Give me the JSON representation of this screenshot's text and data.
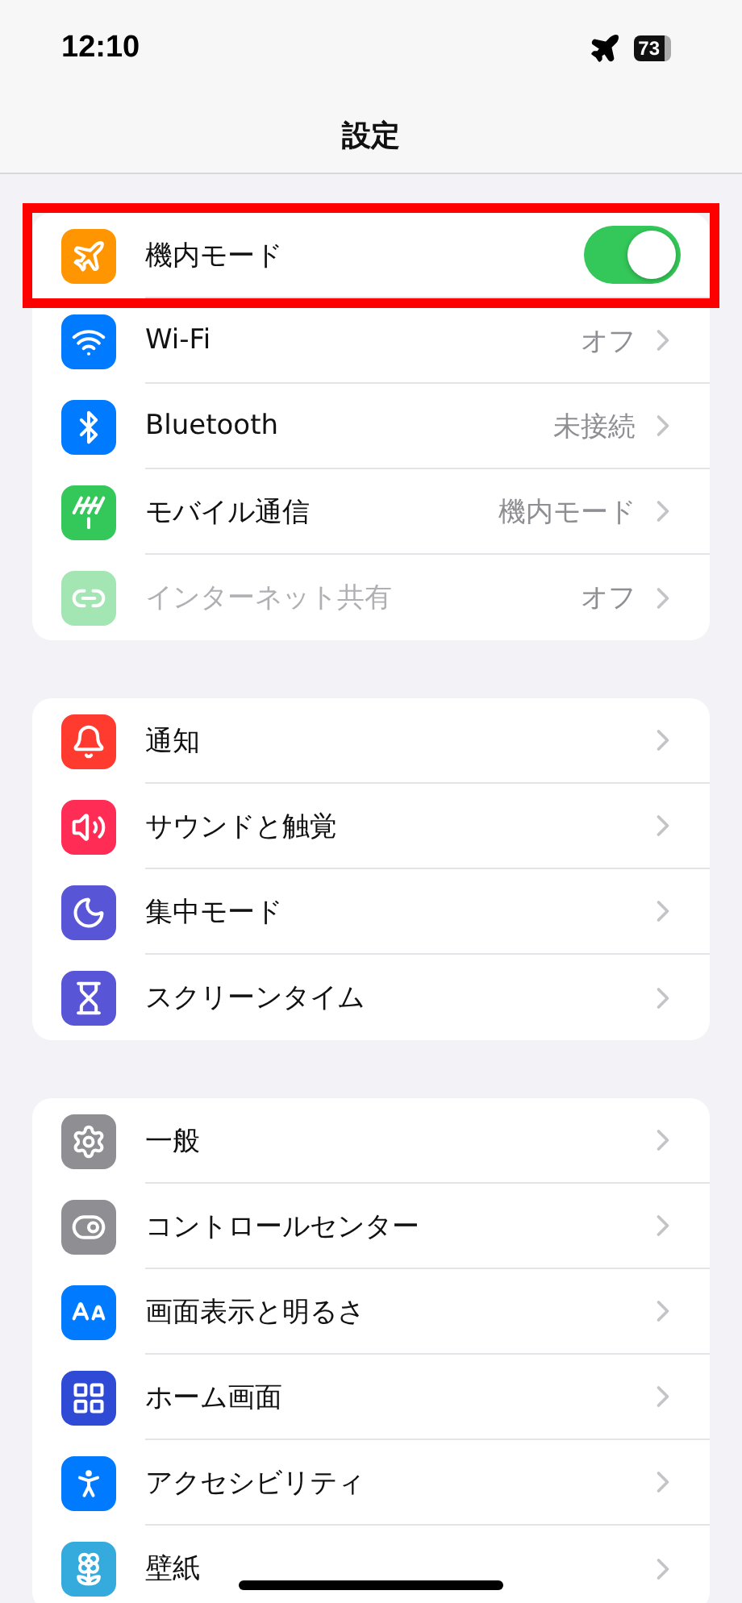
{
  "status_bar": {
    "time": "12:10",
    "airplane_mode": true,
    "battery": "73"
  },
  "nav": {
    "title": "設定"
  },
  "groups": [
    {
      "rows": [
        {
          "kind": "toggle",
          "label": "機内モード",
          "on": true,
          "highlighted": true,
          "disabled": false
        },
        {
          "kind": "link",
          "label": "Wi-Fi",
          "value": "オフ",
          "highlighted": false,
          "disabled": false
        },
        {
          "kind": "link",
          "label": "Bluetooth",
          "value": "未接続",
          "highlighted": false,
          "disabled": false
        },
        {
          "kind": "link",
          "label": "モバイル通信",
          "value": "機内モード",
          "highlighted": false,
          "disabled": false
        },
        {
          "kind": "link",
          "label": "インターネット共有",
          "value": "オフ",
          "highlighted": false,
          "disabled": true
        }
      ]
    },
    {
      "rows": [
        {
          "kind": "link",
          "label": "通知",
          "highlighted": false,
          "disabled": false
        },
        {
          "kind": "link",
          "label": "サウンドと触覚",
          "highlighted": false,
          "disabled": false
        },
        {
          "kind": "link",
          "label": "集中モード",
          "highlighted": false,
          "disabled": false
        },
        {
          "kind": "link",
          "label": "スクリーンタイム",
          "highlighted": false,
          "disabled": false
        }
      ]
    },
    {
      "rows": [
        {
          "kind": "link",
          "label": "一般",
          "highlighted": false,
          "disabled": false
        },
        {
          "kind": "link",
          "label": "コントロールセンター",
          "highlighted": false,
          "disabled": false
        },
        {
          "kind": "link",
          "label": "画面表示と明るさ",
          "highlighted": false,
          "disabled": false
        },
        {
          "kind": "link",
          "label": "ホーム画面",
          "highlighted": false,
          "disabled": false
        },
        {
          "kind": "link",
          "label": "アクセシビリティ",
          "highlighted": false,
          "disabled": false
        },
        {
          "kind": "link",
          "label": "壁紙",
          "highlighted": false,
          "disabled": false
        }
      ]
    }
  ]
}
